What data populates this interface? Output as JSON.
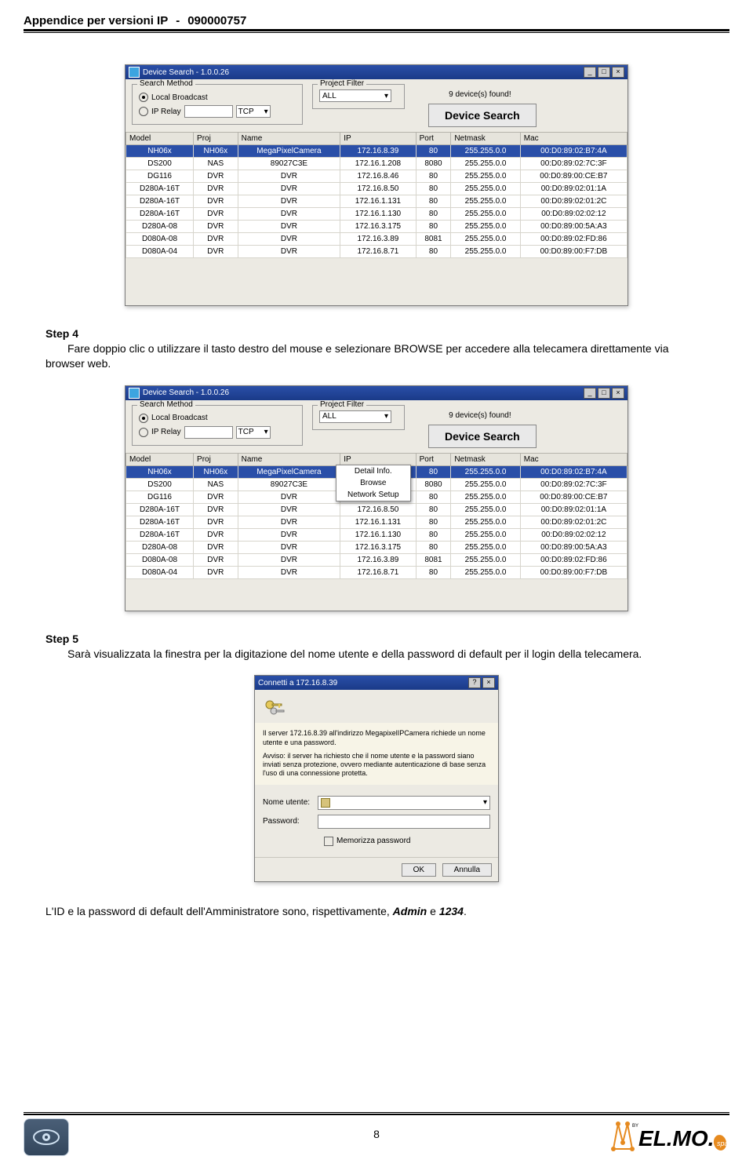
{
  "header": {
    "title": "Appendice per versioni IP",
    "sep": "-",
    "code": "090000757"
  },
  "ds": {
    "title": "Device Search - 1.0.0.26",
    "search_method_label": "Search Method",
    "opt_local": "Local Broadcast",
    "opt_iprelay": "IP Relay",
    "tcp_label": "TCP",
    "proj_filter_label": "Project Filter",
    "proj_filter_value": "ALL",
    "found": "9 device(s) found!",
    "button": "Device Search",
    "columns": [
      "Model",
      "Proj",
      "Name",
      "IP",
      "Port",
      "Netmask",
      "Mac"
    ],
    "rows": [
      {
        "model": "NH06x",
        "proj": "NH06x",
        "name": "MegaPixelCamera",
        "ip": "172.16.8.39",
        "port": "80",
        "mask": "255.255.0.0",
        "mac": "00:D0:89:02:B7:4A"
      },
      {
        "model": "DS200",
        "proj": "NAS",
        "name": "89027C3E",
        "ip": "172.16.1.208",
        "port": "8080",
        "mask": "255.255.0.0",
        "mac": "00:D0:89:02:7C:3F"
      },
      {
        "model": "DG116",
        "proj": "DVR",
        "name": "DVR",
        "ip": "172.16.8.46",
        "port": "80",
        "mask": "255.255.0.0",
        "mac": "00:D0:89:00:CE:B7"
      },
      {
        "model": "D280A-16T",
        "proj": "DVR",
        "name": "DVR",
        "ip": "172.16.8.50",
        "port": "80",
        "mask": "255.255.0.0",
        "mac": "00:D0:89:02:01:1A"
      },
      {
        "model": "D280A-16T",
        "proj": "DVR",
        "name": "DVR",
        "ip": "172.16.1.131",
        "port": "80",
        "mask": "255.255.0.0",
        "mac": "00:D0:89:02:01:2C"
      },
      {
        "model": "D280A-16T",
        "proj": "DVR",
        "name": "DVR",
        "ip": "172.16.1.130",
        "port": "80",
        "mask": "255.255.0.0",
        "mac": "00:D0:89:02:02:12"
      },
      {
        "model": "D280A-08",
        "proj": "DVR",
        "name": "DVR",
        "ip": "172.16.3.175",
        "port": "80",
        "mask": "255.255.0.0",
        "mac": "00:D0:89:00:5A:A3"
      },
      {
        "model": "D080A-08",
        "proj": "DVR",
        "name": "DVR",
        "ip": "172.16.3.89",
        "port": "8081",
        "mask": "255.255.0.0",
        "mac": "00:D0:89:02:FD:86"
      },
      {
        "model": "D080A-04",
        "proj": "DVR",
        "name": "DVR",
        "ip": "172.16.8.71",
        "port": "80",
        "mask": "255.255.0.0",
        "mac": "00:D0:89:00:F7:DB"
      }
    ],
    "ctx": {
      "detail": "Detail Info.",
      "browse": "Browse",
      "net": "Network Setup"
    }
  },
  "step4": {
    "title": "Step 4",
    "text": "Fare doppio clic o utilizzare il tasto destro del mouse e selezionare BROWSE per accedere alla telecamera direttamente via browser web."
  },
  "step5": {
    "title": "Step 5",
    "text": "Sarà visualizzata la finestra per la digitazione del nome utente e della password di default per il login della telecamera."
  },
  "auth": {
    "title": "Connetti a 172.16.8.39",
    "server_line": "Il server 172.16.8.39 all'indirizzo MegapixelIPCamera richiede un nome utente e una password.",
    "warn": "Avviso: il server ha richiesto che il nome utente e la password siano inviati senza protezione, ovvero mediante autenticazione di base senza l'uso di una connessione protetta.",
    "user_label": "Nome utente:",
    "pass_label": "Password:",
    "remember": "Memorizza password",
    "ok": "OK",
    "cancel": "Annulla"
  },
  "final_before": "L'ID e la password di default dell'Amministratore sono, rispettivamente, ",
  "final_admin": "Admin",
  "final_mid": " e ",
  "final_pw": "1234",
  "final_after": ".",
  "page_number": "8",
  "brand": "EL.MO."
}
